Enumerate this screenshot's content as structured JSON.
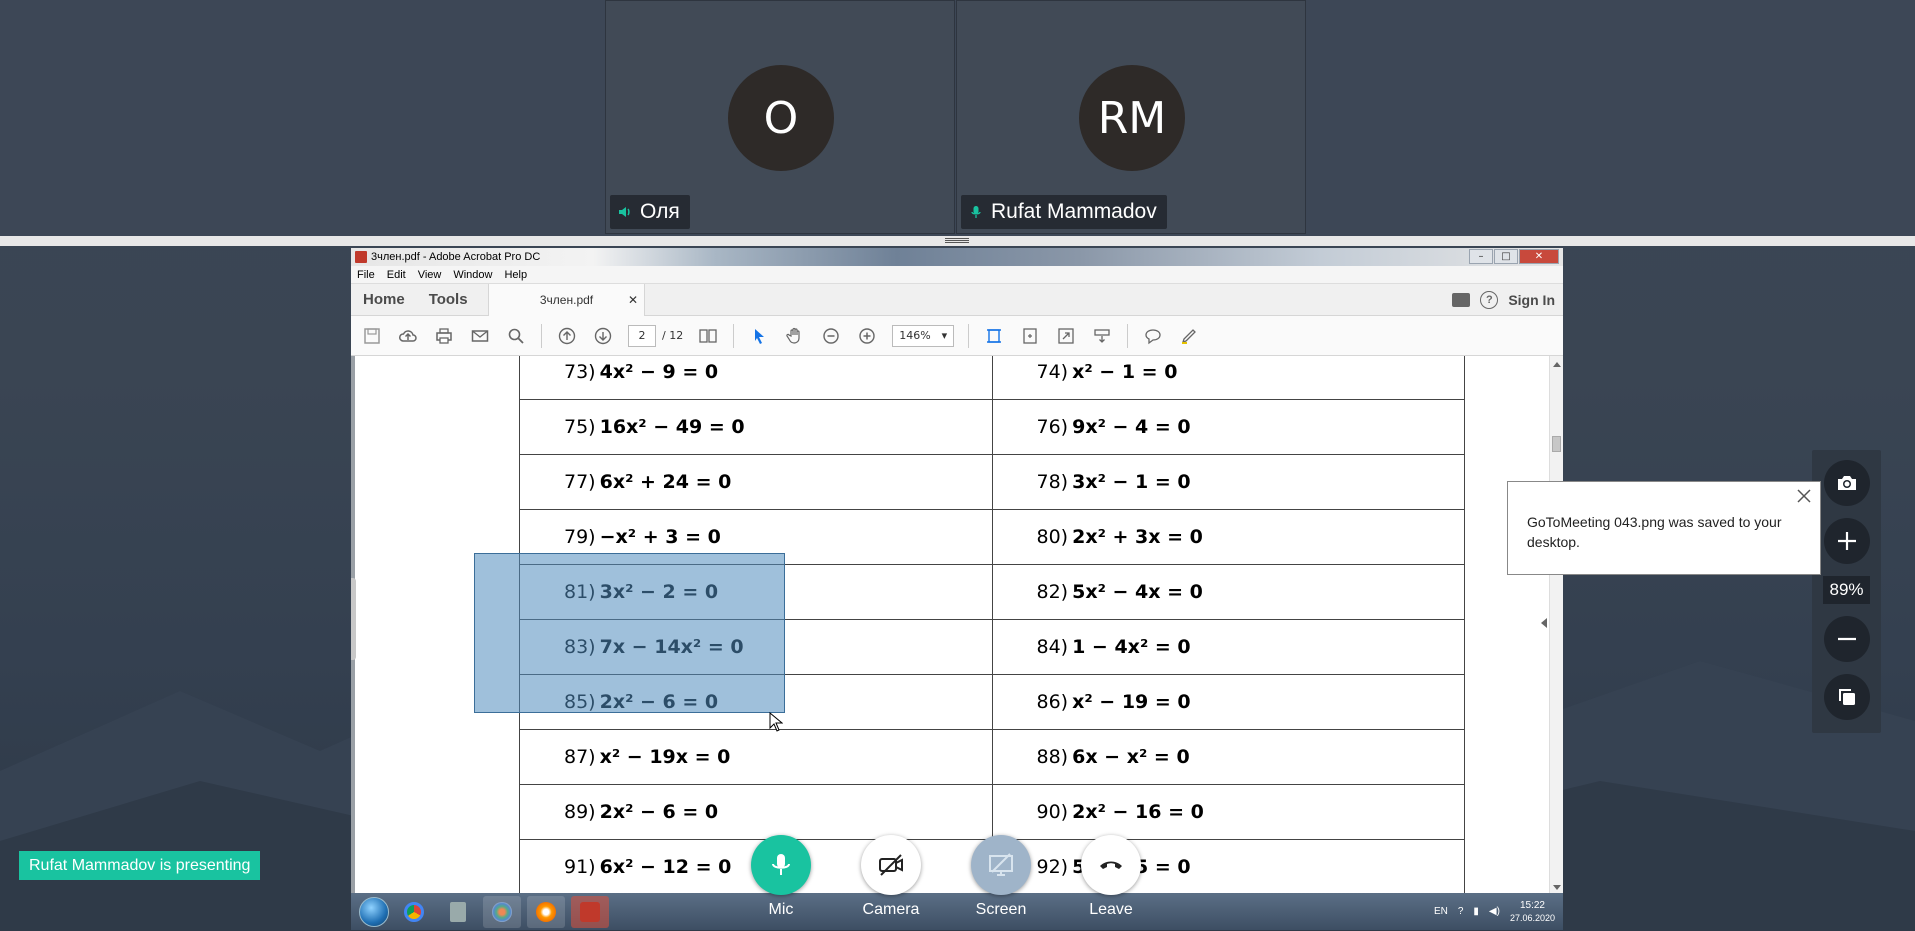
{
  "participants": [
    {
      "initials": "O",
      "name": "Оля",
      "status": "speaker-icon"
    },
    {
      "initials": "RM",
      "name": "Rufat Mammadov",
      "status": "mic-icon"
    }
  ],
  "acrobat": {
    "window_title": "3член.pdf - Adobe Acrobat Pro DC",
    "menu": [
      "File",
      "Edit",
      "View",
      "Window",
      "Help"
    ],
    "tabs": {
      "home": "Home",
      "tools": "Tools",
      "document": "3член.pdf",
      "sign_in": "Sign In"
    },
    "page_current": "2",
    "page_total": "/ 12",
    "zoom": "146%"
  },
  "equations": [
    [
      {
        "num": "73)",
        "eq": "4x² − 9 = 0"
      },
      {
        "num": "74)",
        "eq": "x² − 1 = 0"
      }
    ],
    [
      {
        "num": "75)",
        "eq": "16x² − 49 = 0"
      },
      {
        "num": "76)",
        "eq": "9x² − 4 = 0"
      }
    ],
    [
      {
        "num": "77)",
        "eq": "6x² + 24 = 0"
      },
      {
        "num": "78)",
        "eq": "3x² − 1 = 0"
      }
    ],
    [
      {
        "num": "79)",
        "eq": "−x² + 3 = 0"
      },
      {
        "num": "80)",
        "eq": "2x² + 3x = 0"
      }
    ],
    [
      {
        "num": "81)",
        "eq": "3x² − 2 = 0"
      },
      {
        "num": "82)",
        "eq": "5x² − 4x = 0"
      }
    ],
    [
      {
        "num": "83)",
        "eq": "7x − 14x² = 0"
      },
      {
        "num": "84)",
        "eq": "1 − 4x² = 0"
      }
    ],
    [
      {
        "num": "85)",
        "eq": "2x² − 6 = 0"
      },
      {
        "num": "86)",
        "eq": "x² − 19 = 0"
      }
    ],
    [
      {
        "num": "87)",
        "eq": "x² − 19x = 0"
      },
      {
        "num": "88)",
        "eq": "6x − x² = 0"
      }
    ],
    [
      {
        "num": "89)",
        "eq": "2x² − 6 = 0"
      },
      {
        "num": "90)",
        "eq": "2x² − 16 = 0"
      }
    ],
    [
      {
        "num": "91)",
        "eq": "6x² − 12 = 0"
      },
      {
        "num": "92)",
        "eq": "5x² − 5 = 0"
      }
    ]
  ],
  "taskbar": {
    "lang": "EN",
    "time": "15:22",
    "date": "27.06.2020"
  },
  "presenting_banner": "Rufat Mammadov is presenting",
  "controls": {
    "mic": "Mic",
    "camera": "Camera",
    "screen": "Screen",
    "leave": "Leave"
  },
  "zoom_panel": {
    "percent": "89%"
  },
  "toast": {
    "message": "GoToMeeting 043.png was saved to your desktop."
  },
  "colors": {
    "accent": "#19c3a0",
    "selection": "#6fa3cc"
  }
}
